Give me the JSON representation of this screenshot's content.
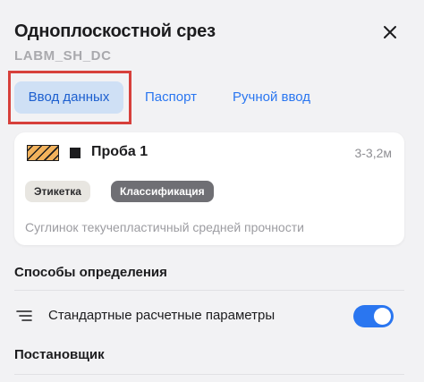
{
  "header": {
    "title": "Одноплоскостной срез",
    "subtitle": "LABM_SH_DC",
    "close_icon": "close-icon"
  },
  "tabs": [
    {
      "label": "Ввод данных",
      "active": true
    },
    {
      "label": "Паспорт",
      "active": false
    },
    {
      "label": "Ручной ввод",
      "active": false
    }
  ],
  "sample_card": {
    "name": "Проба 1",
    "depth": "3-3,2м",
    "hatch_color": "#f2b25c",
    "chips": [
      {
        "label": "Этикетка"
      },
      {
        "label": "Классификация"
      }
    ],
    "description": "Суглинок текучепластичный средней прочности"
  },
  "methods": {
    "title": "Способы определения",
    "row": {
      "icon": "list-icon",
      "label": "Стандартные расчетные параметры",
      "toggle_on": true
    }
  },
  "setter": {
    "title": "Постановщик"
  },
  "colors": {
    "accent": "#2a76f0",
    "highlight_border": "#d7403b"
  }
}
